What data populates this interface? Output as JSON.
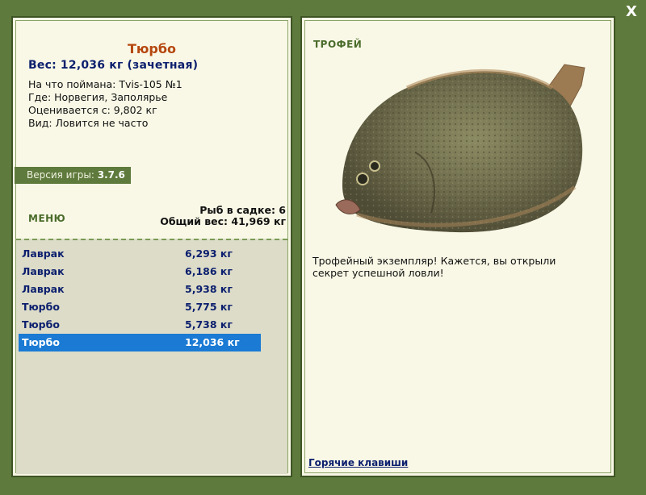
{
  "close_label": "X",
  "fish": {
    "title": "Тюрбо",
    "weight_line": "Вес: 12,036 кг (зачетная)",
    "caught_with": "На что поймана: Tvis-105 №1",
    "location": "Где: Норвегия, Заполярье",
    "threshold": "Оценивается с: 9,802 кг",
    "rarity": "Вид: Ловится не часто"
  },
  "version": {
    "label": "Версия игры:",
    "value": "3.7.6"
  },
  "menu_label": "МЕНЮ",
  "stats": {
    "count_line": "Рыб в садке: 6",
    "total_line": "Общий вес: 41,969 кг"
  },
  "catch_list": [
    {
      "name": "Лаврак",
      "weight": "6,293 кг"
    },
    {
      "name": "Лаврак",
      "weight": "6,186 кг"
    },
    {
      "name": "Лаврак",
      "weight": "5,938 кг"
    },
    {
      "name": "Тюрбо",
      "weight": "5,775 кг"
    },
    {
      "name": "Тюрбо",
      "weight": "5,738 кг"
    },
    {
      "name": "Тюрбо",
      "weight": "12,036 кг"
    }
  ],
  "selected_index": 5,
  "trophy": {
    "label": "ТРОФЕЙ",
    "message": "Трофейный экземпляр! Кажется, вы открыли секрет успешной ловли!"
  },
  "hotkeys_label": "Горячие клавиши",
  "colors": {
    "frame": "#5e7a3c",
    "panel": "#f9f8e6",
    "title_orange": "#b5470f",
    "text_navy": "#0c1f6e",
    "selection": "#1a7ad4",
    "list_bg": "#dcdcc8"
  }
}
